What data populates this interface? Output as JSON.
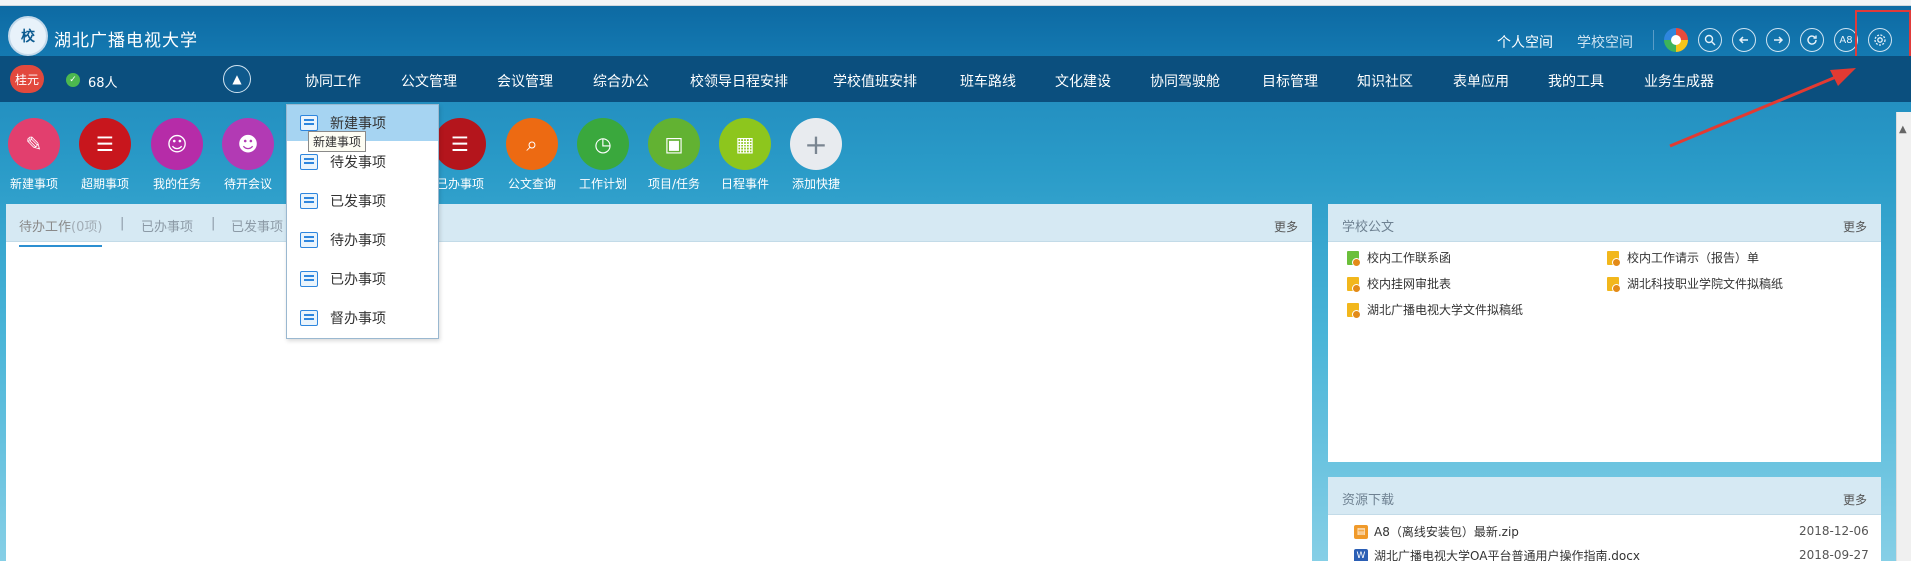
{
  "header": {
    "app_title": "湖北广播电视大学",
    "logo_text": "校",
    "space_tabs": [
      {
        "label": "个人空间",
        "active": true
      },
      {
        "label": "学校空间",
        "active": false
      }
    ],
    "icons": [
      "color-wheel-icon",
      "search-icon",
      "back-icon",
      "forward-icon",
      "refresh-icon",
      "a8-icon",
      "settings-icon"
    ],
    "a8_label": "A8"
  },
  "navbar": {
    "user_name": "桂元",
    "online_count": "68人",
    "items": [
      "协同工作",
      "公文管理",
      "会议管理",
      "综合办公",
      "校领导日程安排",
      "学校值班安排",
      "班车路线",
      "文化建设",
      "协同驾驶舱",
      "目标管理",
      "知识社区",
      "表单应用",
      "我的工具",
      "业务生成器"
    ]
  },
  "shortcuts": [
    {
      "label": "新建事项",
      "color": "#e23f6e",
      "icon": "new-item-icon"
    },
    {
      "label": "超期事项",
      "color": "#c8161d",
      "icon": "overdue-icon"
    },
    {
      "label": "我的任务",
      "color": "#b62ca8",
      "icon": "task-icon"
    },
    {
      "label": "待开会议",
      "color": "#b23ab4",
      "icon": "meeting-icon"
    },
    {
      "label": "已办事项",
      "color": "#b4151c",
      "icon": "done-icon"
    },
    {
      "label": "公文查询",
      "color": "#ed6a12",
      "icon": "doc-query-icon"
    },
    {
      "label": "工作计划",
      "color": "#3aa83d",
      "icon": "plan-icon"
    },
    {
      "label": "项目/任务",
      "color": "#62b232",
      "icon": "project-icon"
    },
    {
      "label": "日程事件",
      "color": "#8dc61d",
      "icon": "calendar-icon"
    },
    {
      "label": "添加快捷",
      "color": "#e8ebef",
      "icon": "add-icon"
    }
  ],
  "work_panel": {
    "tabs": [
      {
        "label": "待办工作",
        "count": "(0项)"
      },
      {
        "label": "已办事项"
      },
      {
        "label": "已发事项"
      }
    ],
    "more": "更多"
  },
  "dropdown": {
    "items": [
      "新建事项",
      "待发事项",
      "已发事项",
      "待办事项",
      "已办事项",
      "督办事项"
    ],
    "tooltip": "新建事项"
  },
  "school_docs": {
    "title": "学校公文",
    "more": "更多",
    "items": [
      {
        "label": "校内工作联系函",
        "type": "green"
      },
      {
        "label": "校内工作请示（报告）单",
        "type": "yellow"
      },
      {
        "label": "校内挂网审批表",
        "type": "yellow"
      },
      {
        "label": "湖北科技职业学院文件拟稿纸",
        "type": "yellow"
      },
      {
        "label": "湖北广播电视大学文件拟稿纸",
        "type": "yellow"
      }
    ]
  },
  "downloads": {
    "title": "资源下载",
    "more": "更多",
    "items": [
      {
        "name": "A8（离线安装包）最新.zip",
        "date": "2018-12-06",
        "type": "zip"
      },
      {
        "name": "湖北广播电视大学OA平台普通用户操作指南.docx",
        "date": "2018-09-27",
        "type": "docx"
      }
    ]
  }
}
